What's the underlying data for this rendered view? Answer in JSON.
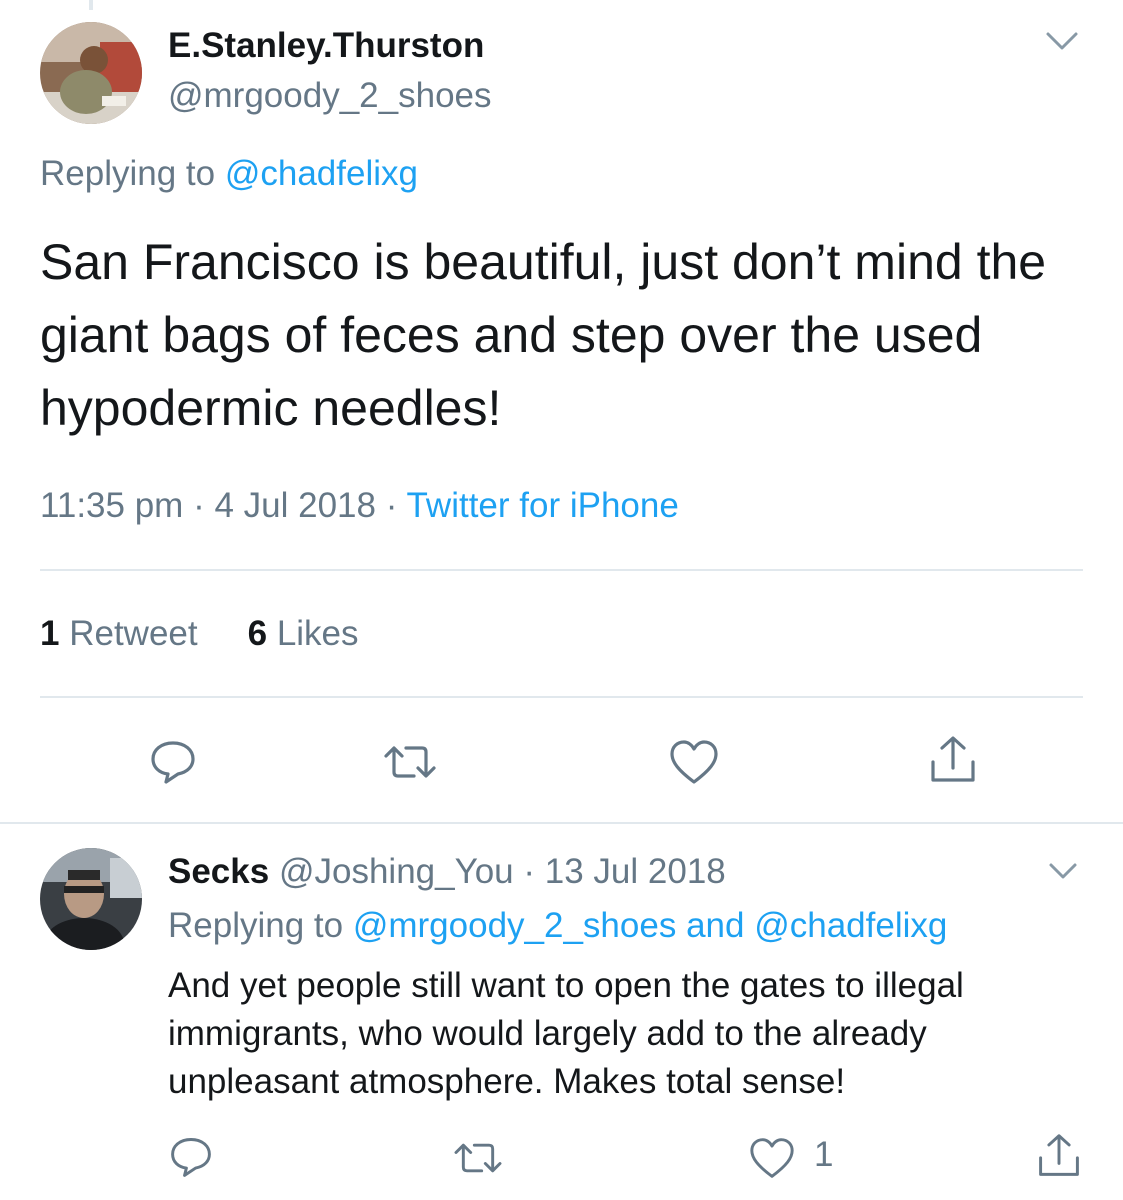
{
  "main_tweet": {
    "display_name": "E.Stanley.Thurston",
    "handle": "@mrgoody_2_shoes",
    "replying_prefix": "Replying to ",
    "replying_to": "@chadfelixg",
    "text": "San Francisco is beautiful, just don’t mind the giant bags of feces and step over the used hypodermic needles!",
    "time": "11:35 pm",
    "date": "4 Jul 2018",
    "source": "Twitter for iPhone",
    "separator": "·",
    "retweet_count": "1",
    "retweet_label": "Retweet",
    "like_count": "6",
    "like_label": "Likes"
  },
  "reply_tweet": {
    "display_name": "Secks",
    "handle": "@Joshing_You",
    "separator": "·",
    "date": "13 Jul 2018",
    "replying_prefix": "Replying to ",
    "replying_to_1": "@mrgoody_2_shoes",
    "replying_and": "and",
    "replying_to_2": "@chadfelixg",
    "text": "And yet people still want to open the gates to illegal immigrants, who would largely add to the already unpleasant atmosphere. Makes total sense!",
    "like_count": "1"
  },
  "icons": [
    "chevron-down-icon",
    "reply-icon",
    "retweet-icon",
    "like-icon",
    "share-icon"
  ],
  "colors": {
    "link": "#1da1f2",
    "secondary_text": "#657786",
    "primary_text": "#14171a",
    "divider": "#e1e8ed"
  }
}
